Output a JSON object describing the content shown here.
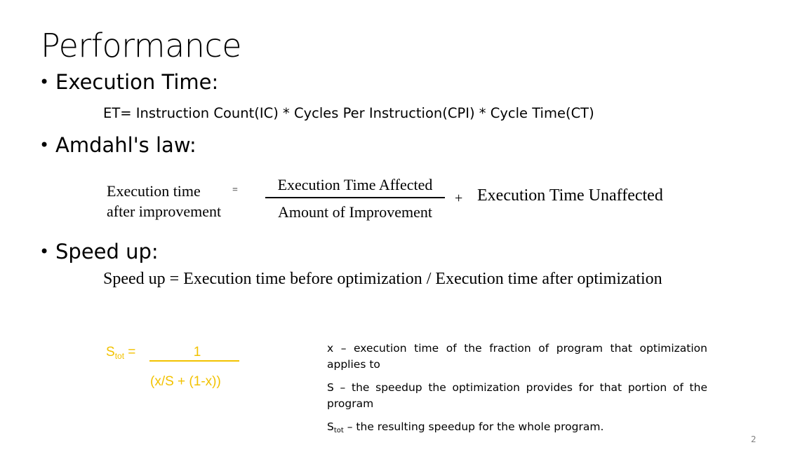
{
  "slide": {
    "title": "Performance",
    "page_number": "2"
  },
  "bullets": {
    "bullet_char": "•",
    "execution_time": {
      "heading": "Execution Time:",
      "formula": "ET= Instruction Count(IC) * Cycles Per Instruction(CPI) * Cycle Time(CT)"
    },
    "amdahl": {
      "heading": "Amdahl's law:",
      "lhs_line1": "Execution time",
      "lhs_line2": "after improvement",
      "equals": "=",
      "numerator": "Execution Time Affected",
      "denominator": "Amount of Improvement",
      "plus": "+",
      "rhs": "Execution Time Unaffected"
    },
    "speed_up": {
      "heading": "Speed up:",
      "formula": "Speed up = Execution time before optimization / Execution time after optimization"
    }
  },
  "stot_formula": {
    "symbol": "S",
    "subscript": "tot",
    "equals": " =",
    "numerator": "1",
    "denominator": "(x/S + (1-x))",
    "color": "#f2c200"
  },
  "definitions": {
    "x_def": "x – execution time of the fraction of program that optimization applies to",
    "s_def": "S – the speedup the optimization provides for that portion of the program",
    "stot_symbol": "S",
    "stot_subscript": "tot",
    "stot_def": " – the resulting speedup for the whole program."
  }
}
